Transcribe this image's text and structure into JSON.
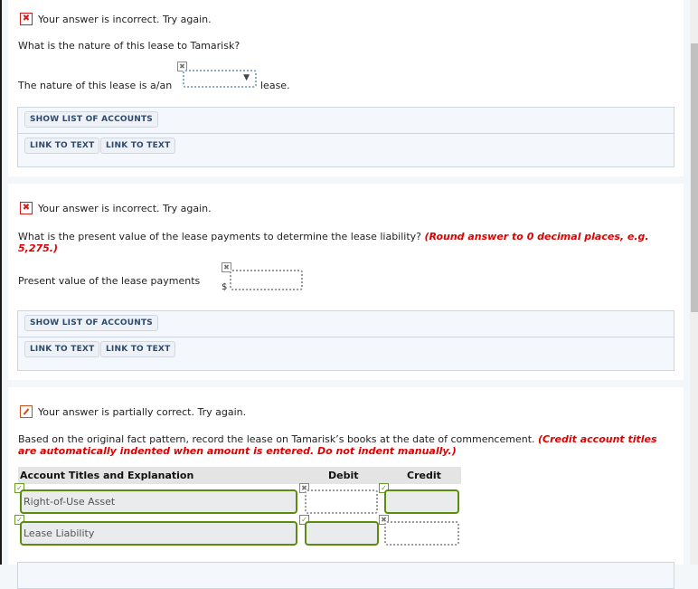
{
  "questions": [
    {
      "status": {
        "icon": "incorrect-x-icon",
        "text": "Your answer is incorrect.  Try again."
      },
      "prompt": "What is the nature of this lease to Tamarisk?",
      "sentence_before": "The nature of this lease is a/an",
      "sentence_after": "lease.",
      "dropdown": {
        "selected": "",
        "marker": "incorrect-x-icon",
        "arrow": "▼"
      },
      "buttons": {
        "show_accounts": "SHOW LIST OF ACCOUNTS",
        "link1": "LINK TO TEXT",
        "link2": "LINK TO TEXT"
      }
    },
    {
      "status": {
        "icon": "incorrect-x-icon",
        "text": "Your answer is incorrect.  Try again."
      },
      "prompt": "What is the present value of the lease payments to determine the lease liability?",
      "note": "(Round answer to 0 decimal places, e.g. 5,275.)",
      "field_label": "Present value of the lease payments",
      "currency": "$",
      "value": "",
      "buttons": {
        "show_accounts": "SHOW LIST OF ACCOUNTS",
        "link1": "LINK TO TEXT",
        "link2": "LINK TO TEXT"
      }
    },
    {
      "status": {
        "icon": "partially-correct-icon",
        "text": "Your answer is partially correct.  Try again."
      },
      "prompt": "Based on the original fact pattern, record the lease on Tamarisk’s books at the date of commencement.",
      "note": "(Credit account titles are automatically indented when amount is entered. Do not indent manually.)",
      "table": {
        "headers": [
          "Account Titles and Explanation",
          "Debit",
          "Credit"
        ],
        "rows": [
          {
            "account": "Right-of-Use Asset",
            "account_mark": "correct",
            "debit": "",
            "debit_mark": "incorrect",
            "credit": "",
            "credit_mark": "correct"
          },
          {
            "account": "Lease Liability",
            "account_mark": "correct",
            "debit": "",
            "debit_mark": "correct",
            "credit": "",
            "credit_mark": "incorrect"
          }
        ]
      }
    }
  ],
  "marks": {
    "correct": "✓",
    "incorrect": "✖"
  },
  "colors": {
    "incorrect": "#d41c1c",
    "partial": "#c8501e",
    "correct_border": "#5b8c10",
    "note_red": "#e00000"
  }
}
